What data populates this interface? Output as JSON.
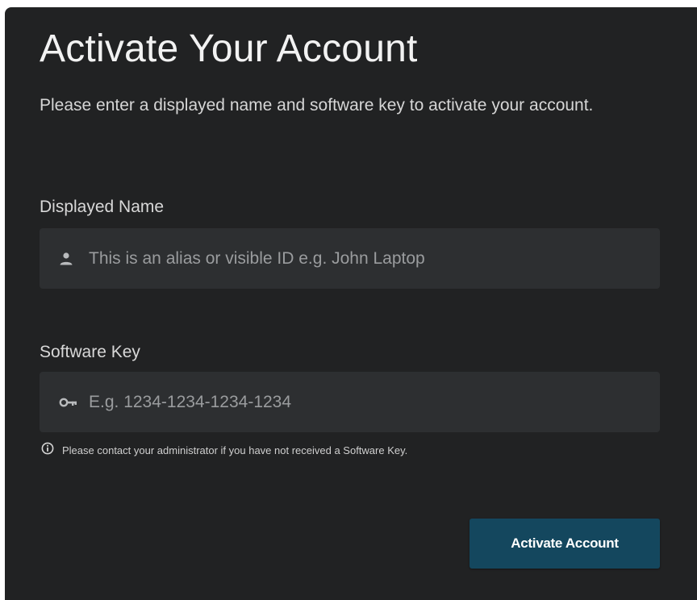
{
  "form": {
    "title": "Activate Your Account",
    "description": "Please enter a displayed name and software key to activate your account.",
    "fields": {
      "displayed_name": {
        "label": "Displayed Name",
        "value": "",
        "placeholder": "This is an alias or visible ID e.g. John Laptop",
        "icon": "person-icon"
      },
      "software_key": {
        "label": "Software Key",
        "value": "",
        "placeholder": "E.g. 1234-1234-1234-1234",
        "icon": "key-icon"
      }
    },
    "hint": {
      "icon": "info-icon",
      "text": "Please contact your administrator if you have not received a Software Key."
    },
    "submit_label": "Activate Account"
  },
  "colors": {
    "panel_background": "#212223",
    "input_background": "#2d2f31",
    "button_background": "#14475e",
    "text_primary": "#f2f2f2",
    "placeholder_text": "#9a9c9e"
  }
}
